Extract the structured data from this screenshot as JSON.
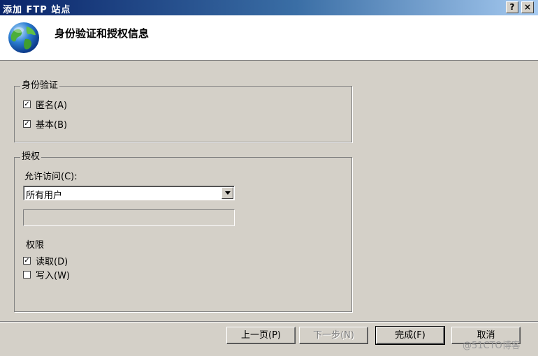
{
  "window": {
    "title": "添加 FTP 站点",
    "help_glyph": "?",
    "close_glyph": "×"
  },
  "header": {
    "heading": "身份验证和授权信息",
    "icon": "globe-icon"
  },
  "authentication": {
    "legend": "身份验证",
    "anonymous": {
      "label": "匿名(A)",
      "checked": true
    },
    "basic": {
      "label": "基本(B)",
      "checked": true
    }
  },
  "authorization": {
    "legend": "授权",
    "allow_access_label": "允许访问(C):",
    "allow_access_value": "所有用户",
    "permissions_label": "权限",
    "read": {
      "label": "读取(D)",
      "checked": true
    },
    "write": {
      "label": "写入(W)",
      "checked": false
    }
  },
  "buttons": {
    "previous": "上一页(P)",
    "next": "下一步(N)",
    "finish": "完成(F)",
    "cancel": "取消"
  },
  "watermark": "@51CTO博客",
  "check_glyph": "✓"
}
